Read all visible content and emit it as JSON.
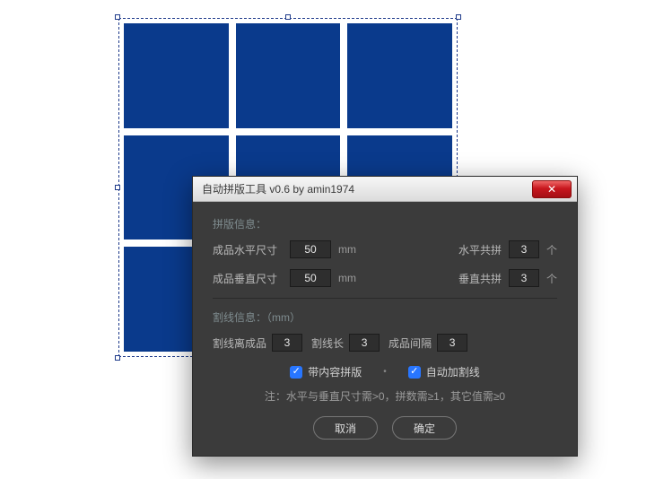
{
  "titlebar": {
    "title": "自动拼版工具 v0.6   by amin1974"
  },
  "section1": {
    "heading": "拼版信息：",
    "hSizeLabel": "成品水平尺寸",
    "hSizeValue": "50",
    "hUnit": "mm",
    "hCountLabel": "水平共拼",
    "hCountValue": "3",
    "hCountUnit": "个",
    "vSizeLabel": "成品垂直尺寸",
    "vSizeValue": "50",
    "vUnit": "mm",
    "vCountLabel": "垂直共拼",
    "vCountValue": "3",
    "vCountUnit": "个"
  },
  "section2": {
    "heading": "割线信息：（mm）",
    "offsetLabel": "割线离成品",
    "offsetValue": "3",
    "lenLabel": "割线长",
    "lenValue": "3",
    "gapLabel": "成品间隔",
    "gapValue": "3"
  },
  "checks": {
    "withContentLabel": "带内容拼版",
    "withContentChecked": true,
    "autoCutLabel": "自动加割线",
    "autoCutChecked": true
  },
  "note": "注：水平与垂直尺寸需>0，拼数需≥1，其它值需≥0",
  "buttons": {
    "cancel": "取消",
    "ok": "确定"
  }
}
